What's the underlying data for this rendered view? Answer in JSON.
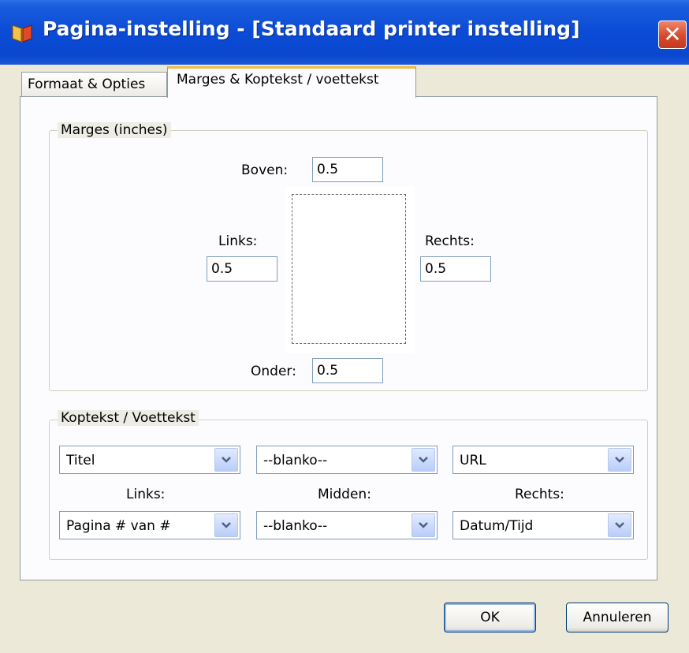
{
  "window": {
    "title": "Pagina-instelling - [Standaard printer instelling]",
    "close_symbol": "✕",
    "app_icon": "book-icon"
  },
  "tabs": [
    {
      "label": "Formaat & Opties",
      "active": false
    },
    {
      "label": "Marges & Koptekst / voettekst",
      "active": true
    }
  ],
  "margins": {
    "legend": "Marges (inches)",
    "top": {
      "label": "Boven:",
      "value": "0.5"
    },
    "left": {
      "label": "Links:",
      "value": "0.5"
    },
    "right": {
      "label": "Rechts:",
      "value": "0.5"
    },
    "bottom": {
      "label": "Onder:",
      "value": "0.5"
    }
  },
  "headers_footers": {
    "legend": "Koptekst / Voettekst",
    "header": {
      "left": "Titel",
      "center": "--blanko--",
      "right": "URL"
    },
    "labels": {
      "left": "Links:",
      "center": "Midden:",
      "right": "Rechts:"
    },
    "footer": {
      "left": "Pagina # van #",
      "center": "--blanko--",
      "right": "Datum/Tijd"
    }
  },
  "buttons": {
    "ok": "OK",
    "cancel": "Annuleren"
  },
  "colors": {
    "titlebar": "#0b4bd6",
    "close": "#d9482a",
    "active_tab_accent": "#f3b64a",
    "dialog_bg": "#ece9d8"
  }
}
